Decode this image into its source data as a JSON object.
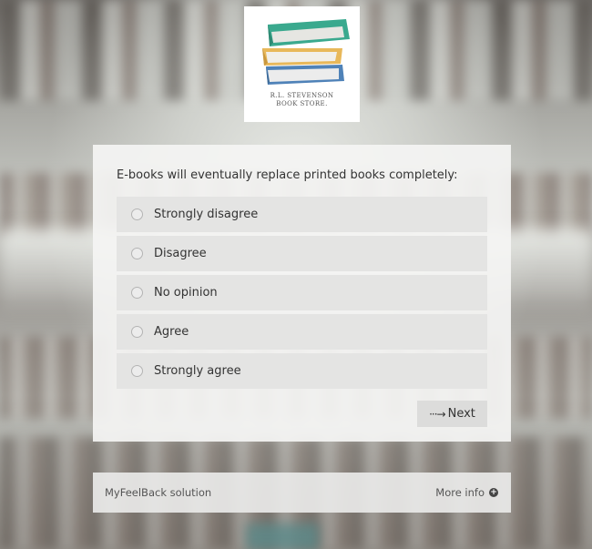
{
  "logo": {
    "line1": "R.L. STEVENSON",
    "line2": "BOOK STORE.",
    "colors": {
      "top_book": "#3aa98e",
      "middle_book": "#e8b85a",
      "bottom_book": "#4f82b8"
    }
  },
  "survey": {
    "question": "E-books will eventually replace printed books completely:",
    "options": [
      {
        "label": "Strongly disagree"
      },
      {
        "label": "Disagree"
      },
      {
        "label": "No opinion"
      },
      {
        "label": "Agree"
      },
      {
        "label": "Strongly agree"
      }
    ],
    "next_label": "Next",
    "next_icon": "dotted-arrow-right-icon"
  },
  "footer": {
    "brand": "MyFeelBack solution",
    "more_info_label": "More info",
    "more_info_icon": "plus-circle-icon"
  }
}
